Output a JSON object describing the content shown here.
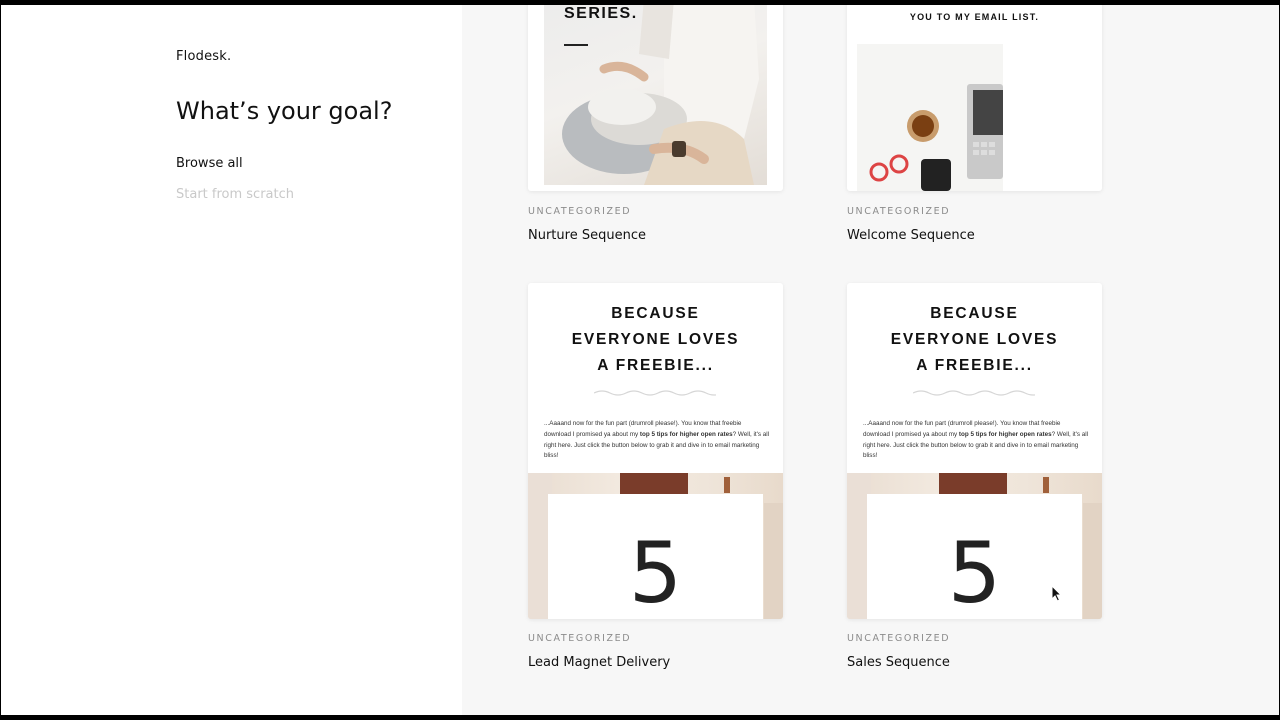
{
  "brand": {
    "logo": "Flodesk."
  },
  "sidebar": {
    "heading": "What’s your goal?",
    "items": [
      {
        "label": "Browse all"
      },
      {
        "label": "Start from scratch"
      }
    ]
  },
  "templates": [
    {
      "category": "UNCATEGORIZED",
      "title": "Nurture Sequence",
      "preview_text": "SERIES."
    },
    {
      "category": "UNCATEGORIZED",
      "title": "Welcome Sequence",
      "preview_text": "YOU TO MY EMAIL LIST."
    },
    {
      "category": "UNCATEGORIZED",
      "title": "Lead Magnet Delivery",
      "preview_heading": [
        "BECAUSE",
        "EVERYONE LOVES",
        "A FREEBIE..."
      ],
      "preview_body_start": "...Aaaand now for the fun part (drumroll please!). You know that freebie download I promised ya about my ",
      "preview_body_bold": "top 5 tips for higher open rates",
      "preview_body_end": "? Well, it's all right here. Just click the button below to grab it and dive in to email marketing bliss!",
      "preview_number": "5"
    },
    {
      "category": "UNCATEGORIZED",
      "title": "Sales Sequence",
      "preview_heading": [
        "BECAUSE",
        "EVERYONE LOVES",
        "A FREEBIE..."
      ],
      "preview_body_start": "...Aaaand now for the fun part (drumroll please!). You know that freebie download I promised ya about my ",
      "preview_body_bold": "top 5 tips for higher open rates",
      "preview_body_end": "? Well, it's all right here. Just click the button below to grab it and dive in to email marketing bliss!",
      "preview_number": "5"
    }
  ],
  "colors": {
    "sidebar_bg": "#ffffff",
    "main_bg": "#f7f7f7",
    "text": "#111111",
    "muted_nav": "#c9c9c9",
    "category": "#8c8c8c"
  }
}
